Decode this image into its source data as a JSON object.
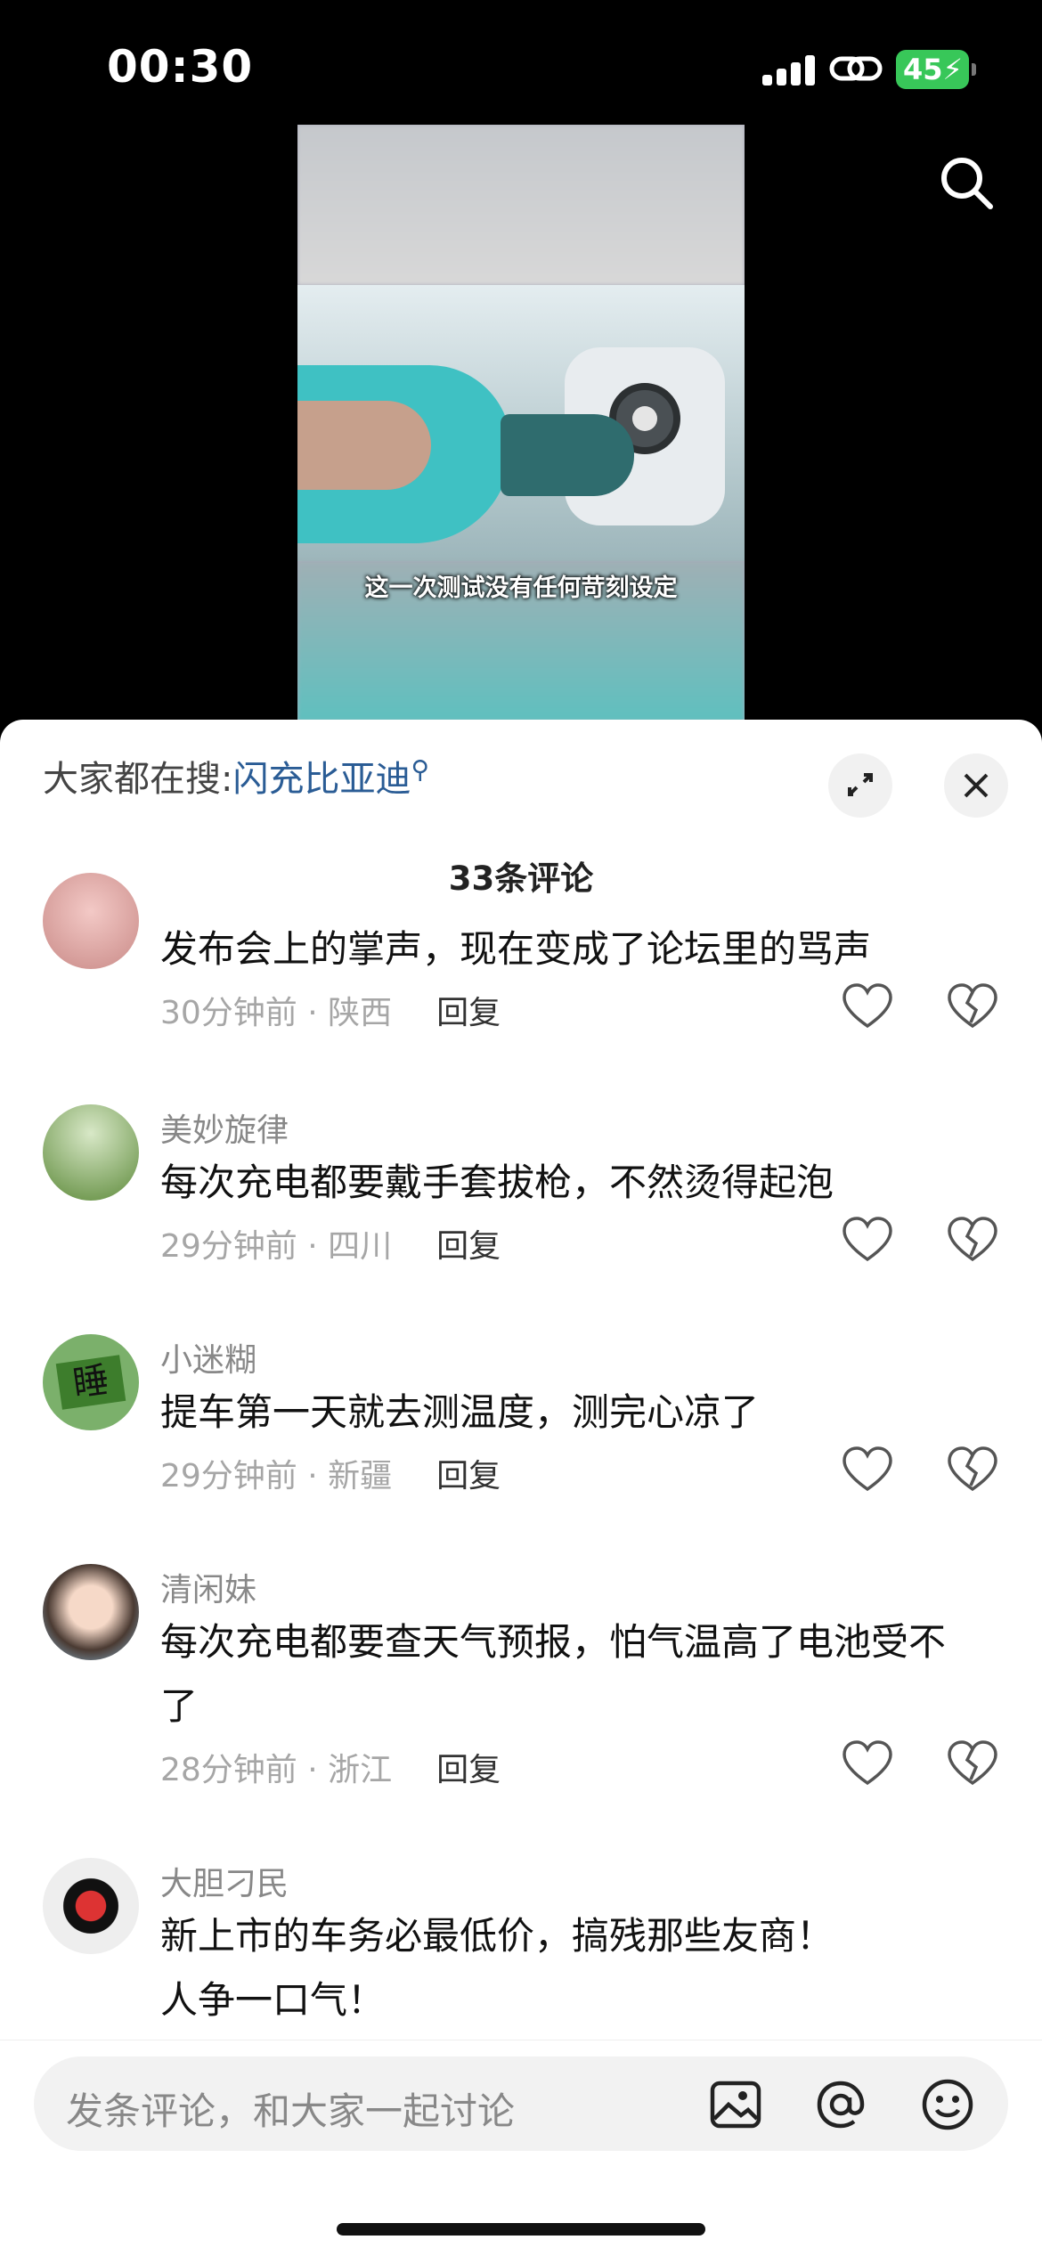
{
  "status": {
    "time": "00:30",
    "battery": "45"
  },
  "video": {
    "caption": "这一次测试没有任何苛刻设定"
  },
  "sheet": {
    "hot_search_prefix": "大家都在搜:",
    "hot_search_term": "闪充比亚迪",
    "comment_count": "33条评论"
  },
  "comments": [
    {
      "user": "",
      "text": "发布会上的掌声，现在变成了论坛里的骂声",
      "meta": "30分钟前 · 陕西",
      "reply": "回复"
    },
    {
      "user": "美妙旋律",
      "text": "每次充电都要戴手套拔枪，不然烫得起泡",
      "meta": "29分钟前 · 四川",
      "reply": "回复"
    },
    {
      "user": "小迷糊",
      "text": "提车第一天就去测温度，测完心凉了",
      "meta": "29分钟前 · 新疆",
      "reply": "回复"
    },
    {
      "user": "清闲妹",
      "text": "每次充电都要查天气预报，怕气温高了电池受不了",
      "meta": "28分钟前 · 浙江",
      "reply": "回复"
    },
    {
      "user": "大胆刁民",
      "text_line1": "新上市的车务必最低价，搞残那些友商！",
      "text_line2": "人争一口气！"
    }
  ],
  "avatar_text": {
    "sleep": "睡"
  },
  "input": {
    "placeholder": "发条评论，和大家一起讨论"
  }
}
